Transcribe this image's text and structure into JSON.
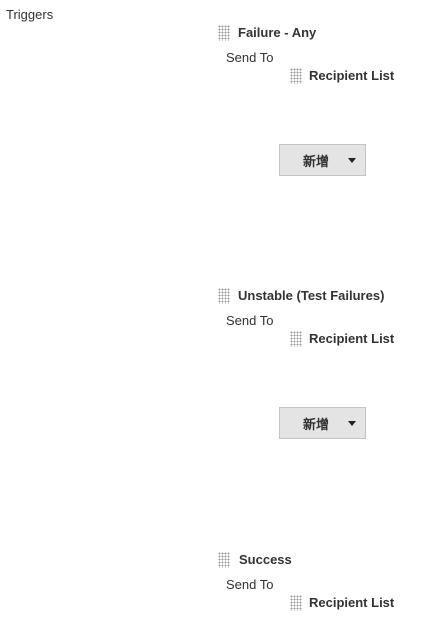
{
  "section_label": "Triggers",
  "triggers": [
    {
      "title": "Failure - Any",
      "send_to_label": "Send To",
      "recipient_label": "Recipient List",
      "add_button_label": "新增"
    },
    {
      "title": "Unstable (Test Failures)",
      "send_to_label": "Send To",
      "recipient_label": "Recipient List",
      "add_button_label": "新增"
    },
    {
      "title": "Success",
      "send_to_label": "Send To",
      "recipient_label": "Recipient List"
    }
  ],
  "icons": {
    "drag_handle": "drag-handle-icon",
    "dropdown": "caret-down-icon"
  }
}
